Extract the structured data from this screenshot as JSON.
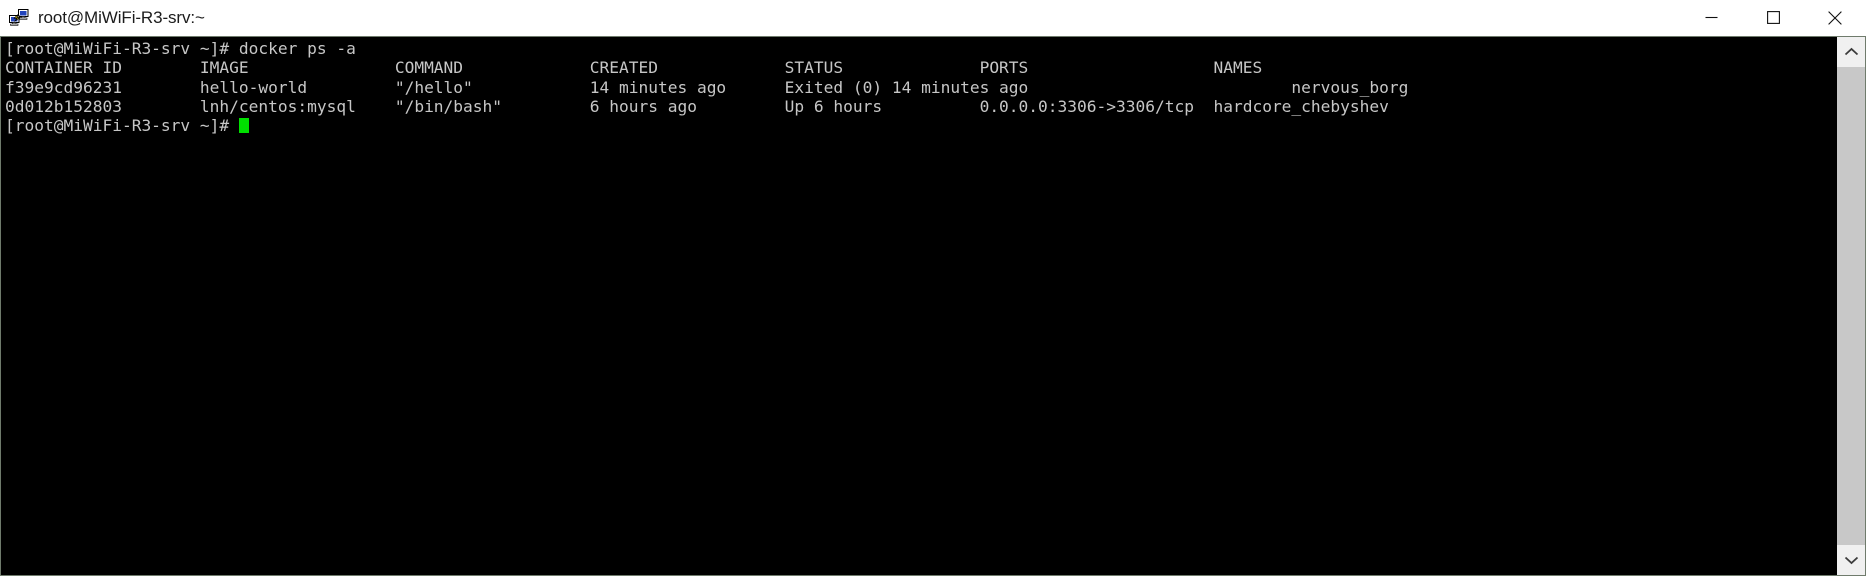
{
  "window": {
    "title": "root@MiWiFi-R3-srv:~",
    "icon": "putty-computers-icon",
    "controls": {
      "minimize_label": "—",
      "maximize_label": "□",
      "close_label": "✕"
    }
  },
  "terminal": {
    "foreground_color": "#c6c6c6",
    "background_color": "#000000",
    "cursor_color": "#00e000",
    "prompt": "[root@MiWiFi-R3-srv ~]#",
    "command": "docker ps -a",
    "lines": [
      "[root@MiWiFi-R3-srv ~]# docker ps -a",
      "CONTAINER ID        IMAGE               COMMAND             CREATED             STATUS              PORTS                   NAMES",
      "f39e9cd96231        hello-world         \"/hello\"            14 minutes ago      Exited (0) 14 minutes ago                           nervous_borg",
      "0d012b152803        lnh/centos:mysql    \"/bin/bash\"         6 hours ago         Up 6 hours          0.0.0.0:3306->3306/tcp  hardcore_chebyshev",
      "[root@MiWiFi-R3-srv ~]# "
    ],
    "table": {
      "headers": [
        "CONTAINER ID",
        "IMAGE",
        "COMMAND",
        "CREATED",
        "STATUS",
        "PORTS",
        "NAMES"
      ],
      "rows": [
        {
          "container_id": "f39e9cd96231",
          "image": "hello-world",
          "command": "\"/hello\"",
          "created": "14 minutes ago",
          "status": "Exited (0) 14 minutes ago",
          "ports": "",
          "names": "nervous_borg"
        },
        {
          "container_id": "0d012b152803",
          "image": "lnh/centos:mysql",
          "command": "\"/bin/bash\"",
          "created": "6 hours ago",
          "status": "Up 6 hours",
          "ports": "0.0.0.0:3306->3306/tcp",
          "names": "hardcore_chebyshev"
        }
      ]
    }
  },
  "scrollbar": {
    "up_arrow": "chevron-up-icon",
    "down_arrow": "chevron-down-icon",
    "thumb_position": "full"
  }
}
